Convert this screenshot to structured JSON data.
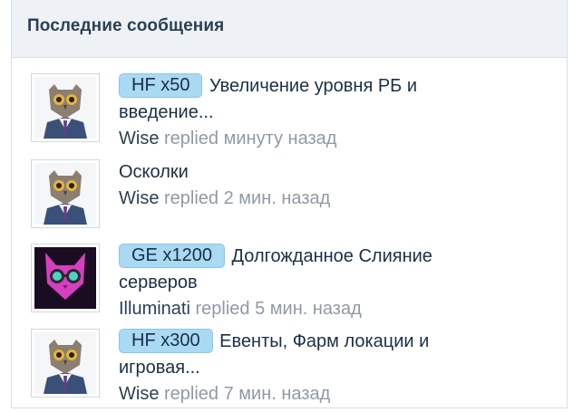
{
  "widget": {
    "title": "Последние сообщения"
  },
  "items": [
    {
      "prefix": "HF x50",
      "title_line1": "Увеличение уровня РБ и",
      "title_line2": "введение...",
      "user": "Wise",
      "action": "replied",
      "time": "минуту назад",
      "avatar": "owl-avatar"
    },
    {
      "prefix": "",
      "title_line1": "Осколки",
      "title_line2": "",
      "user": "Wise",
      "action": "replied",
      "time": "2 мин. назад",
      "avatar": "owl-avatar"
    },
    {
      "prefix": "GE x1200",
      "title_line1": "Долгожданное Слияние",
      "title_line2": "серверов",
      "user": "Illuminati",
      "action": "replied",
      "time": "5 мин. назад",
      "avatar": "pink-cat-avatar"
    },
    {
      "prefix": "HF x300",
      "title_line1": "Евенты, Фарм локации и",
      "title_line2": "игровая...",
      "user": "Wise",
      "action": "replied",
      "time": "7 мин. назад",
      "avatar": "owl-avatar"
    }
  ],
  "colors": {
    "prefix_bg": "#a9d9f3",
    "header_bg": "#eef2f7",
    "muted": "#8f9aa6"
  }
}
